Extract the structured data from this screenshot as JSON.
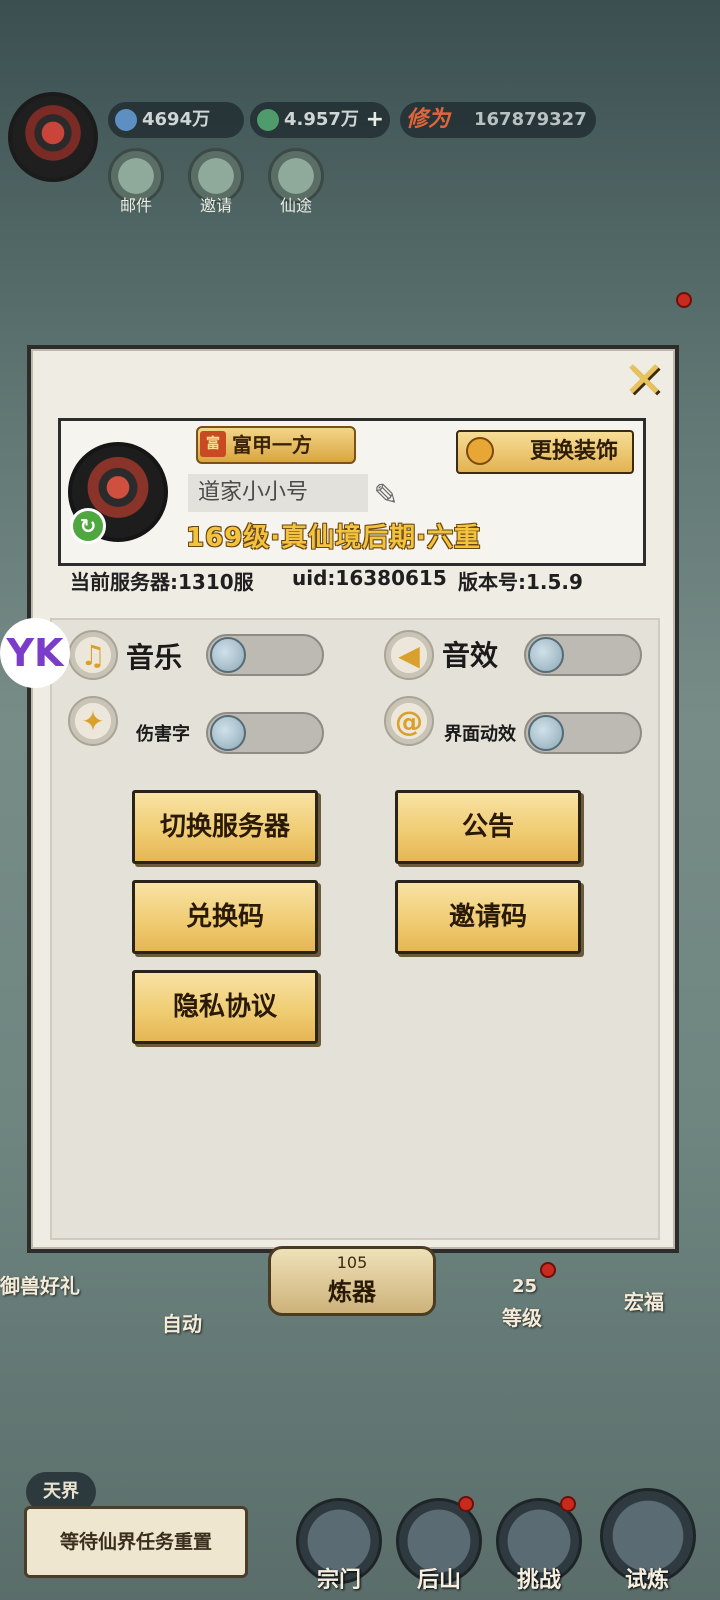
{
  "hud": {
    "currency1": "4694万",
    "currency2": "4.957万",
    "cultivation_label": "修为",
    "cultivation_value": "167879327",
    "top_buttons": [
      {
        "label": "邮件"
      },
      {
        "label": "邀请"
      },
      {
        "label": "仙途"
      }
    ]
  },
  "profile": {
    "title_badge": "富甲一方",
    "title_seal": "富",
    "player_name": "道家小小号",
    "realm": "169级·真仙境后期·六重",
    "change_decor_label": "更换装饰",
    "server": "当前服务器:1310服",
    "uid": "uid:16380615",
    "version": "版本号:1.5.9"
  },
  "settings": {
    "music_label": "音乐",
    "sfx_label": "音效",
    "damage_text_label": "伤害字",
    "ui_anim_label": "界面动效"
  },
  "menu": {
    "switch_server": "切换服务器",
    "notice": "公告",
    "redeem_code": "兑换码",
    "invite_code": "邀请码",
    "privacy": "隐私协议"
  },
  "bottom": {
    "left_side": "御兽好礼",
    "auto": "自动",
    "refine_level": "105",
    "refine_label": "炼器",
    "level_num": "25",
    "level_label": "等级",
    "right_side": "宏福",
    "realm_tag": "天界",
    "task_text": "等待仙界任务重置",
    "nav": [
      "宗门",
      "后山",
      "挑战",
      "试炼"
    ]
  },
  "watermark": "YK"
}
